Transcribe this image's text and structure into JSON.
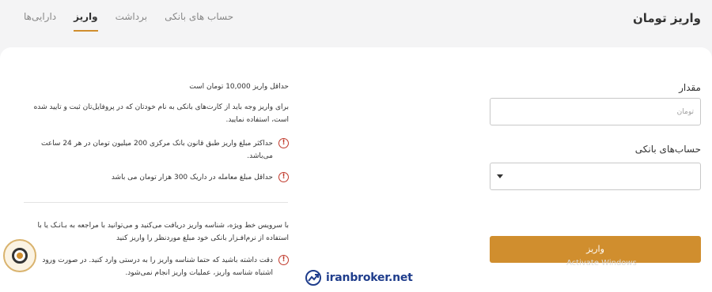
{
  "header": {
    "title": "واریز تومان",
    "tabs": [
      {
        "label": "دارایی‌ها",
        "active": false
      },
      {
        "label": "واریز",
        "active": true
      },
      {
        "label": "برداشت",
        "active": false
      },
      {
        "label": "حساب های بانکی",
        "active": false
      }
    ]
  },
  "form": {
    "amount_label": "مقدار",
    "amount_placeholder": "تومان",
    "bank_label": "حساب‌های بانکی",
    "bank_selected": "",
    "submit_label": "واریز"
  },
  "info": {
    "min_deposit": "حداقل واریز 10,000 تومان است",
    "card_notice": "برای واریز وجه باید از کارت‌های بانکی به نام خودتان که در پروفایل‌تان ثبت و تایید شده است، استفاده نمایید.",
    "warn_max": "حداکثر مبلغ واریز طبق قانون بانک مرکزی 200 میلیون تومان در هر 24 ساعت می‌باشد.",
    "warn_min_trade": "حداقل مبلغ معامله در داریک 300 هزار تومان می باشد",
    "service_notice": "با سرویس خط ویژه، شناسه واریز دریافت می‌کنید و می‌توانید با مراجعه به بـانـک یا با استفاده از نرم‌افـزار بانکی خود مبلغ موردنظر را واریز کنید",
    "warn_id": "دقت داشته باشید که حتما شناسه واریز را به درستی وارد کنید. در صورت ورود اشتباه شناسه واریز، عملیات واریز انجام نمی‌شود."
  },
  "watermark": {
    "text": "iranbroker.net",
    "activate_windows": "Activate Windows"
  },
  "colors": {
    "accent": "#d08e2e",
    "warning": "#c0392b",
    "brand": "#1f3d8c"
  },
  "icons": {
    "warning": "exclamation-circle-icon",
    "select_caret": "caret-down-icon",
    "support": "support-chat-icon",
    "brand": "trend-line-logo-icon"
  }
}
